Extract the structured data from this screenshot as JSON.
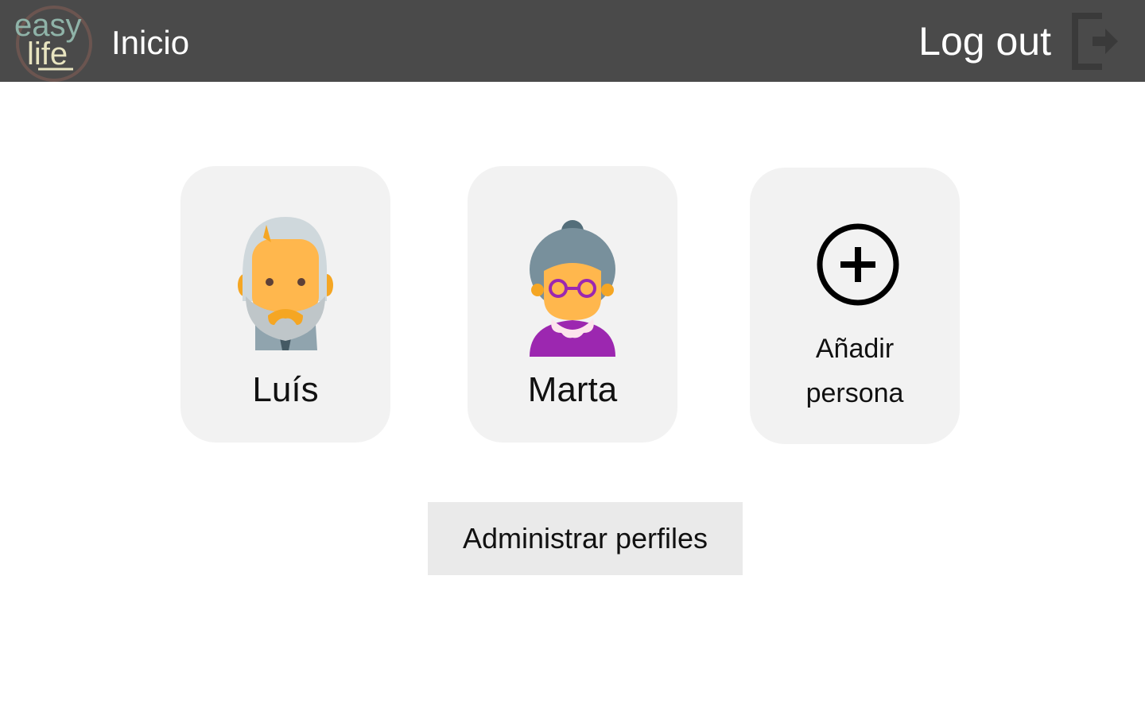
{
  "header": {
    "logo": {
      "line1": "easy",
      "line2": "life",
      "icon": "easylife-logo"
    },
    "title": "Inicio",
    "logout_label": "Log out",
    "logout_icon": "logout-icon"
  },
  "profiles": [
    {
      "name": "Luís",
      "avatar": "elderly-man-avatar"
    },
    {
      "name": "Marta",
      "avatar": "elderly-woman-avatar"
    }
  ],
  "add_profile": {
    "label": "Añadir\npersona",
    "icon": "plus-circle-icon"
  },
  "manage_button": {
    "label": "Administrar perfiles"
  },
  "colors": {
    "header_bg": "#4a4a4a",
    "card_bg": "#f2f2f2",
    "button_bg": "#eaeaea"
  }
}
